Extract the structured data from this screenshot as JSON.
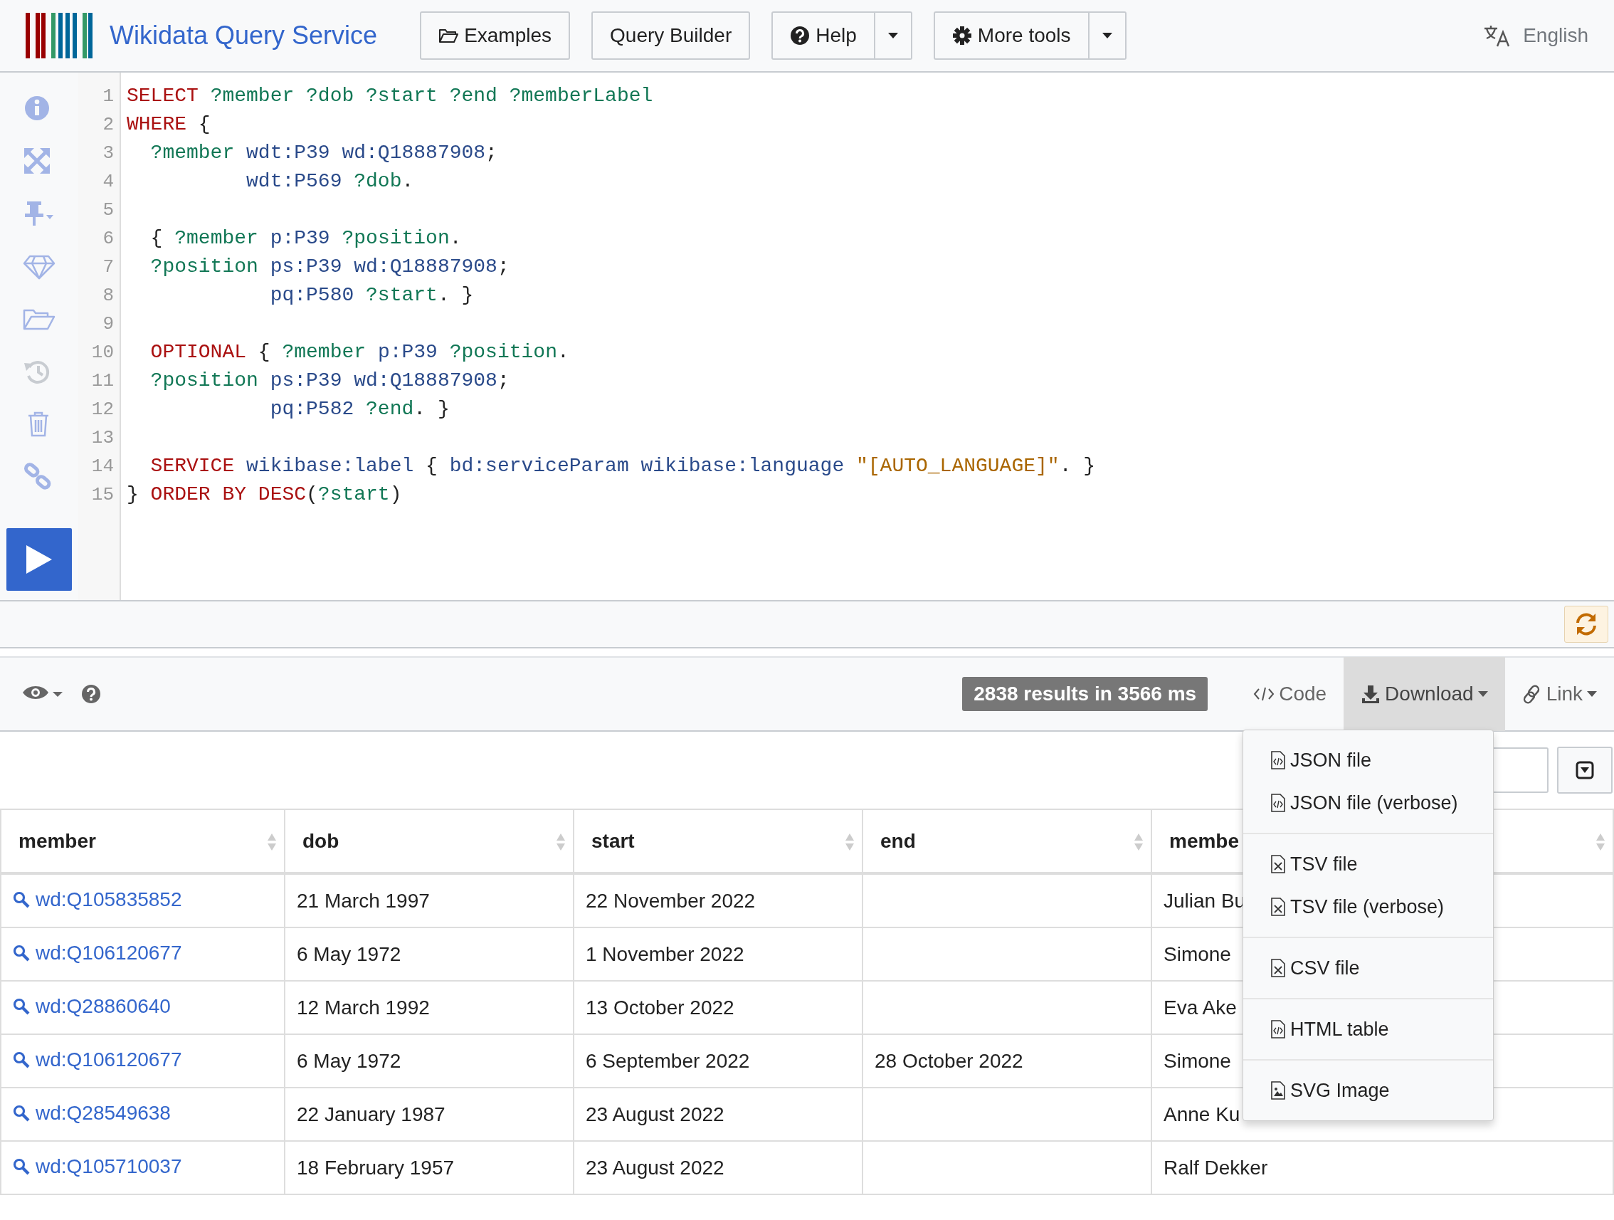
{
  "header": {
    "title": "Wikidata Query Service",
    "buttons": [
      {
        "kind": "examples",
        "label": "Examples",
        "split": false
      },
      {
        "kind": "plain",
        "label": "Query Builder",
        "split": false
      },
      {
        "kind": "help",
        "label": "Help",
        "split": true
      },
      {
        "kind": "tools",
        "label": "More tools",
        "split": true
      }
    ],
    "language": "English"
  },
  "sidebar": {
    "tools": [
      {
        "kind": "info",
        "disabled": false
      },
      {
        "kind": "expand",
        "disabled": false
      },
      {
        "kind": "pin",
        "disabled": false
      },
      {
        "kind": "gem",
        "disabled": false
      },
      {
        "kind": "folder",
        "disabled": false
      },
      {
        "kind": "history",
        "disabled": true
      },
      {
        "kind": "trash",
        "disabled": false
      },
      {
        "kind": "link",
        "disabled": false
      }
    ]
  },
  "editor": {
    "lines": [
      {
        "number": "1",
        "tokens": [
          {
            "kind": "kw",
            "text": "SELECT "
          },
          {
            "kind": "var",
            "text": "?member ?dob ?start ?end ?memberLabel"
          }
        ]
      },
      {
        "number": "2",
        "tokens": [
          {
            "kind": "kw",
            "text": "WHERE "
          },
          {
            "kind": "p",
            "text": "{"
          }
        ]
      },
      {
        "number": "3",
        "tokens": [
          {
            "kind": "var",
            "text": "  ?member "
          },
          {
            "kind": "iri",
            "text": "wdt:P39 wd:Q18887908"
          },
          {
            "kind": "p",
            "text": ";"
          }
        ]
      },
      {
        "number": "4",
        "tokens": [
          {
            "kind": "iri",
            "text": "          wdt:P569 "
          },
          {
            "kind": "var",
            "text": "?dob"
          },
          {
            "kind": "p",
            "text": "."
          }
        ]
      },
      {
        "number": "5"
      },
      {
        "number": "6",
        "tokens": [
          {
            "kind": "p",
            "text": "  { "
          },
          {
            "kind": "var",
            "text": "?member "
          },
          {
            "kind": "iri",
            "text": "p:P39 "
          },
          {
            "kind": "var",
            "text": "?position"
          },
          {
            "kind": "p",
            "text": "."
          }
        ]
      },
      {
        "number": "7",
        "tokens": [
          {
            "kind": "var",
            "text": "  ?position "
          },
          {
            "kind": "iri",
            "text": "ps:P39 wd:Q18887908"
          },
          {
            "kind": "p",
            "text": ";"
          }
        ]
      },
      {
        "number": "8",
        "tokens": [
          {
            "kind": "iri",
            "text": "            pq:P580 "
          },
          {
            "kind": "var",
            "text": "?start"
          },
          {
            "kind": "p",
            "text": ". }"
          }
        ]
      },
      {
        "number": "9"
      },
      {
        "number": "10",
        "tokens": [
          {
            "kind": "kw",
            "text": "  OPTIONAL "
          },
          {
            "kind": "p",
            "text": "{ "
          },
          {
            "kind": "var",
            "text": "?member "
          },
          {
            "kind": "iri",
            "text": "p:P39 "
          },
          {
            "kind": "var",
            "text": "?position"
          },
          {
            "kind": "p",
            "text": "."
          }
        ]
      },
      {
        "number": "11",
        "tokens": [
          {
            "kind": "var",
            "text": "  ?position "
          },
          {
            "kind": "iri",
            "text": "ps:P39 wd:Q18887908"
          },
          {
            "kind": "p",
            "text": ";"
          }
        ]
      },
      {
        "number": "12",
        "tokens": [
          {
            "kind": "iri",
            "text": "            pq:P582 "
          },
          {
            "kind": "var",
            "text": "?end"
          },
          {
            "kind": "p",
            "text": ". }"
          }
        ]
      },
      {
        "number": "13"
      },
      {
        "number": "14",
        "tokens": [
          {
            "kind": "kw",
            "text": "  SERVICE "
          },
          {
            "kind": "iri",
            "text": "wikibase:label "
          },
          {
            "kind": "p",
            "text": "{ "
          },
          {
            "kind": "iri",
            "text": "bd:serviceParam wikibase:language "
          },
          {
            "kind": "str",
            "text": "\"[AUTO_LANGUAGE]\""
          },
          {
            "kind": "p",
            "text": ". }"
          }
        ]
      },
      {
        "number": "15",
        "tokens": [
          {
            "kind": "p",
            "text": "} "
          },
          {
            "kind": "kw",
            "text": "ORDER BY DESC"
          },
          {
            "kind": "p",
            "text": "("
          },
          {
            "kind": "var",
            "text": "?start"
          },
          {
            "kind": "p",
            "text": ")"
          }
        ]
      }
    ]
  },
  "results_toolbar": {
    "summary": "2838 results in 3566 ms",
    "actions": [
      {
        "kind": "code",
        "label": "Code",
        "selected": false
      },
      {
        "kind": "download",
        "label": "Download",
        "selected": true
      },
      {
        "kind": "link",
        "label": "Link",
        "selected": false
      }
    ]
  },
  "download_menu": {
    "groups": [
      [
        {
          "kind": "code",
          "label": "JSON file"
        },
        {
          "kind": "code",
          "label": "JSON file (verbose)"
        }
      ],
      [
        {
          "kind": "sheet",
          "label": "TSV file"
        },
        {
          "kind": "sheet",
          "label": "TSV file (verbose)"
        }
      ],
      [
        {
          "kind": "sheet",
          "label": "CSV file"
        }
      ],
      [
        {
          "kind": "code",
          "label": "HTML table"
        }
      ],
      [
        {
          "kind": "image",
          "label": "SVG Image"
        }
      ]
    ]
  },
  "table": {
    "columns": [
      "member",
      "dob",
      "start",
      "end",
      "membe"
    ],
    "rows": [
      [
        "wd:Q105835852",
        "21 March 1997",
        "22 November 2022",
        "",
        "Julian Bu"
      ],
      [
        "wd:Q106120677",
        "6 May 1972",
        "1 November 2022",
        "",
        "Simone"
      ],
      [
        "wd:Q28860640",
        "12 March 1992",
        "13 October 2022",
        "",
        "Eva Ake"
      ],
      [
        "wd:Q106120677",
        "6 May 1972",
        "6 September 2022",
        "28 October 2022",
        "Simone"
      ],
      [
        "wd:Q28549638",
        "22 January 1987",
        "23 August 2022",
        "",
        "Anne Ku"
      ],
      [
        "wd:Q105710037",
        "18 February 1957",
        "23 August 2022",
        "",
        "Ralf Dekker"
      ]
    ]
  }
}
